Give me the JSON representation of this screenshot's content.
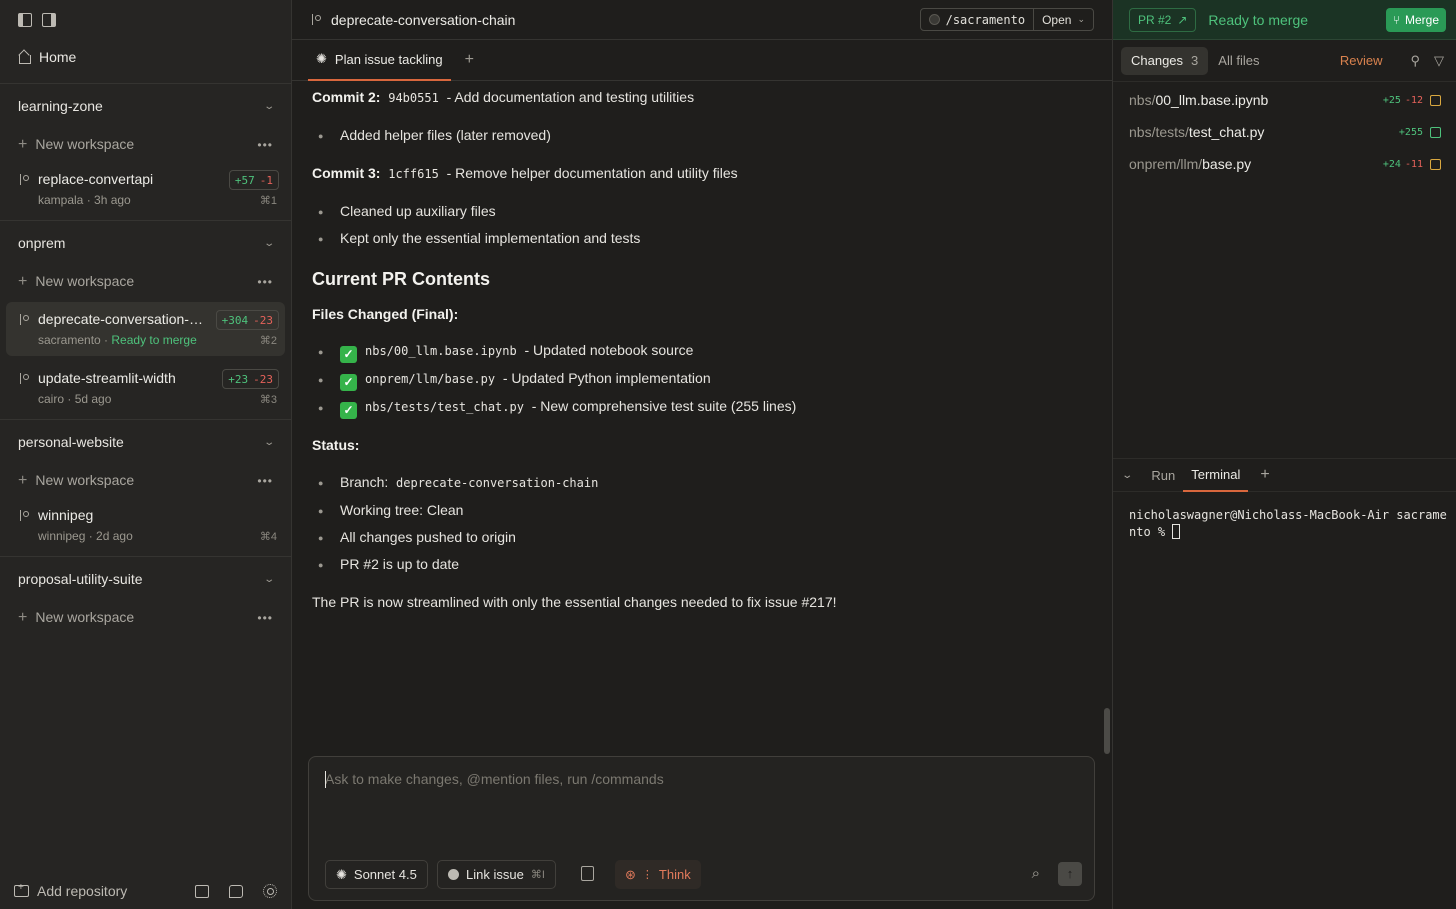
{
  "sidebar": {
    "home": "Home",
    "repos": [
      {
        "name": "learning-zone",
        "new_workspace": "New workspace",
        "workspaces": [
          {
            "name": "replace-convertapi",
            "meta": "kampala",
            "time": "3h ago",
            "add": "+57",
            "del": "-1",
            "shortcut": "⌘1"
          }
        ]
      },
      {
        "name": "onprem",
        "new_workspace": "New workspace",
        "workspaces": [
          {
            "name": "deprecate-conversation-chain",
            "meta": "sacramento",
            "status": "Ready to merge",
            "add": "+304",
            "del": "-23",
            "shortcut": "⌘2"
          },
          {
            "name": "update-streamlit-width",
            "meta": "cairo",
            "time": "5d ago",
            "add": "+23",
            "del": "-23",
            "shortcut": "⌘3"
          }
        ]
      },
      {
        "name": "personal-website",
        "new_workspace": "New workspace",
        "workspaces": [
          {
            "name": "winnipeg",
            "meta": "winnipeg",
            "time": "2d ago",
            "shortcut": "⌘4"
          }
        ]
      },
      {
        "name": "proposal-utility-suite",
        "new_workspace": "New workspace",
        "workspaces": []
      }
    ],
    "add_repository": "Add repository"
  },
  "main": {
    "title": "deprecate-conversation-chain",
    "path": "/sacramento",
    "open_label": "Open",
    "tab": "Plan issue tackling",
    "content": {
      "commit2_label": "Commit 2:",
      "commit2_hash": "94b0551",
      "commit2_desc": "- Add documentation and testing utilities",
      "commit2_bullets": [
        "Added helper files (later removed)"
      ],
      "commit3_label": "Commit 3:",
      "commit3_hash": "1cff615",
      "commit3_desc": "- Remove helper documentation and utility files",
      "commit3_bullets": [
        "Cleaned up auxiliary files",
        "Kept only the essential implementation and tests"
      ],
      "heading": "Current PR Contents",
      "files_label": "Files Changed (Final):",
      "files": [
        {
          "path": "nbs/00_llm.base.ipynb",
          "desc": "- Updated notebook source"
        },
        {
          "path": "onprem/llm/base.py",
          "desc": "- Updated Python implementation"
        },
        {
          "path": "nbs/tests/test_chat.py",
          "desc": "- New comprehensive test suite (255 lines)"
        }
      ],
      "status_label": "Status:",
      "status_branch_label": "Branch:",
      "status_branch": "deprecate-conversation-chain",
      "status_items": [
        "Working tree: Clean",
        "All changes pushed to origin",
        "PR #2 is up to date"
      ],
      "summary": "The PR is now streamlined with only the essential changes needed to fix issue #217!"
    },
    "composer": {
      "placeholder": "Ask to make changes, @mention files, run /commands",
      "model": "Sonnet 4.5",
      "link_issue": "Link issue",
      "link_shortcut": "⌘I",
      "think": "Think"
    }
  },
  "right": {
    "pr": "PR #2",
    "status": "Ready to merge",
    "merge": "Merge",
    "tabs": {
      "changes": "Changes",
      "changes_count": "3",
      "all_files": "All files",
      "review": "Review"
    },
    "files": [
      {
        "dir": "nbs/",
        "name": "00_llm.base.ipynb",
        "add": "+25",
        "del": "-12",
        "type": "modified"
      },
      {
        "dir": "nbs/tests/",
        "name": "test_chat.py",
        "add": "+255",
        "del": "",
        "type": "added"
      },
      {
        "dir": "onprem/llm/",
        "name": "base.py",
        "add": "+24",
        "del": "-11",
        "type": "modified"
      }
    ],
    "terminal_tabs": {
      "run": "Run",
      "terminal": "Terminal"
    },
    "terminal_text": "nicholaswagner@Nicholass-MacBook-Air sacramento % "
  },
  "colors": {
    "accent": "#d9673d",
    "green": "#4ec27c",
    "red": "#e5625a"
  }
}
